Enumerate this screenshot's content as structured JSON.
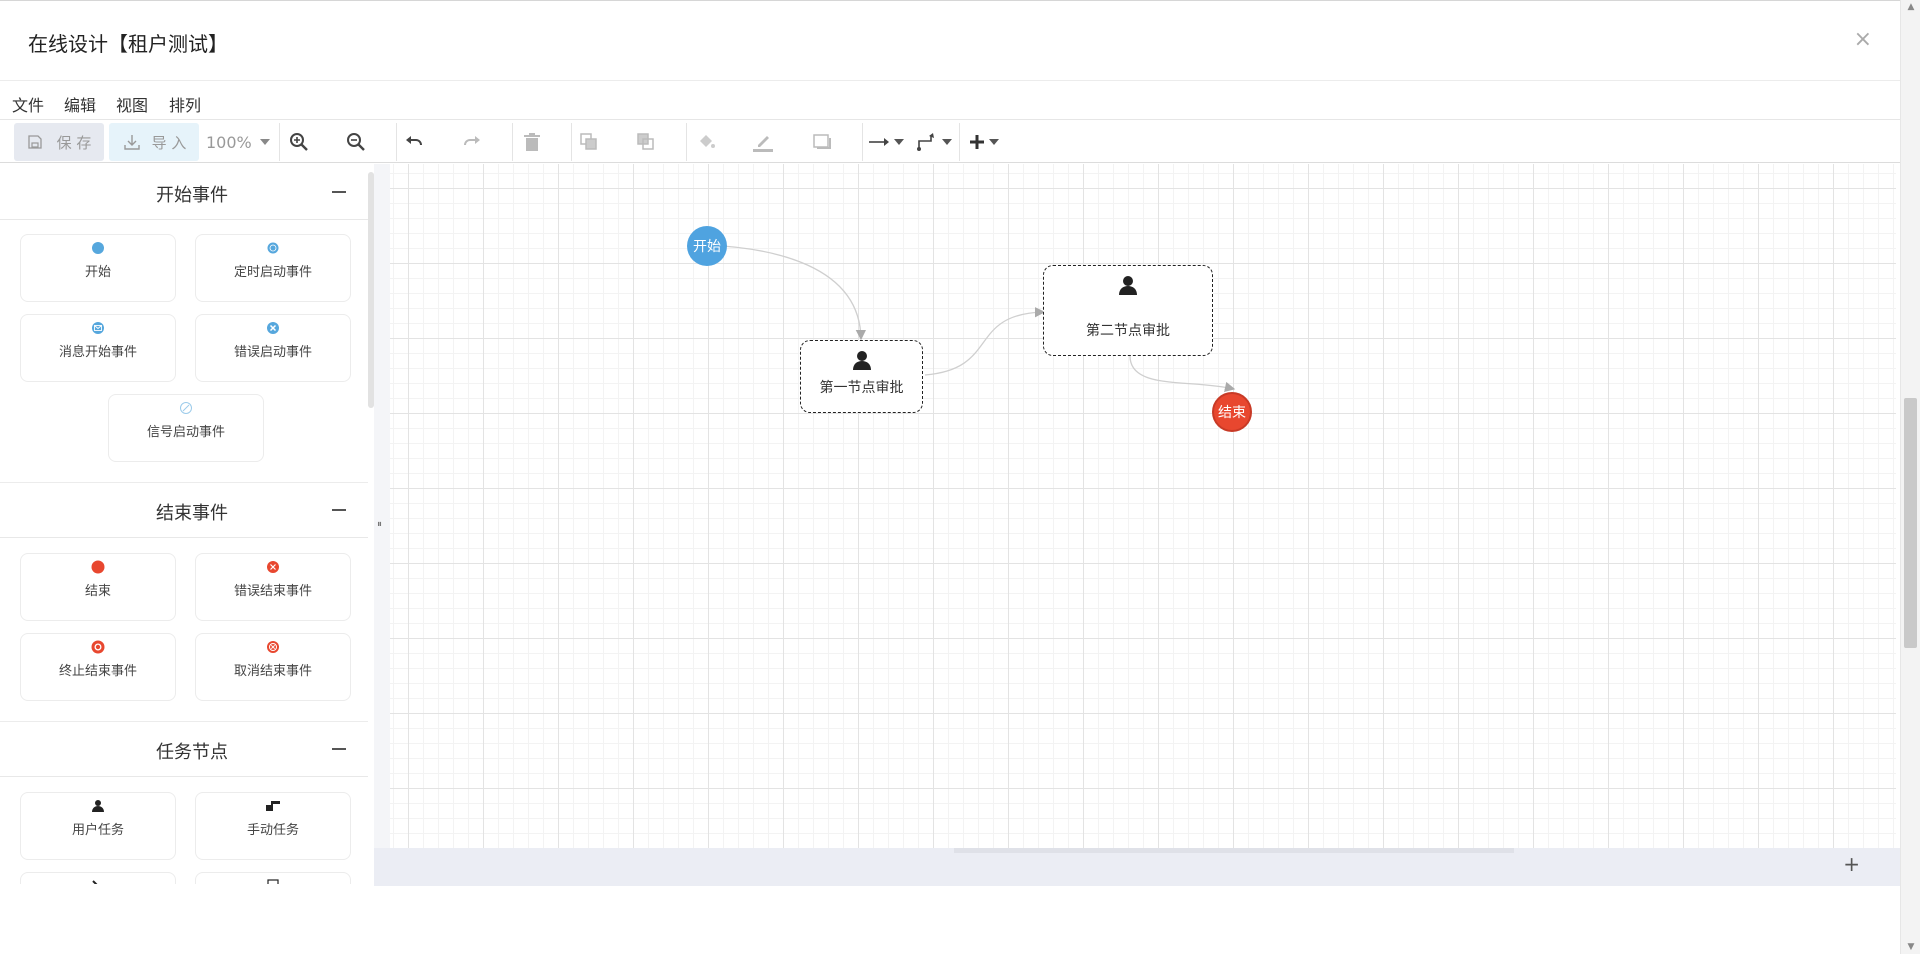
{
  "dialog": {
    "title": "在线设计【租户测试】",
    "close": "×"
  },
  "menu": [
    "文件",
    "编辑",
    "视图",
    "排列"
  ],
  "toolbar": {
    "save": "保 存",
    "import": "导 入",
    "zoom": "100%"
  },
  "palette": {
    "start": {
      "title": "开始事件",
      "items": [
        "开始",
        "定时启动事件",
        "消息开始事件",
        "错误启动事件",
        "信号启动事件"
      ]
    },
    "end": {
      "title": "结束事件",
      "items": [
        "结束",
        "错误结束事件",
        "终止结束事件",
        "取消结束事件"
      ]
    },
    "task": {
      "title": "任务节点",
      "items": [
        "用户任务",
        "手动任务"
      ]
    }
  },
  "diagram": {
    "start": "开始",
    "task1": "第一节点审批",
    "task2": "第二节点审批",
    "end": "结束"
  },
  "colors": {
    "start": "#4fa3e0",
    "end": "#e8472f",
    "accent": "#56a7dd"
  },
  "canvas_plus": "+"
}
